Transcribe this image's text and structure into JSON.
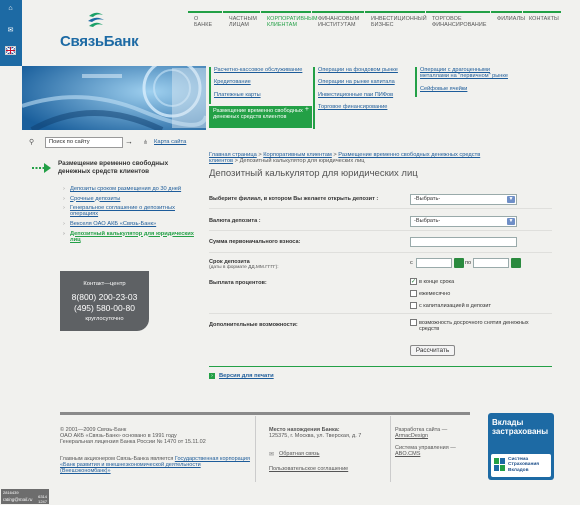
{
  "brand": {
    "name": "СвязьБанк"
  },
  "topnav": [
    {
      "label": "О БАНКЕ",
      "active": false
    },
    {
      "label": "ЧАСТНЫМ ЛИЦАМ",
      "active": false
    },
    {
      "label": "КОРПОРАТИВНЫМ КЛИЕНТАМ",
      "active": true
    },
    {
      "label": "ФИНАНСОВЫМ ИНСТИТУТАМ",
      "active": false
    },
    {
      "label": "ИНВЕСТИЦИОННЫЙ БИЗНЕС",
      "active": false
    },
    {
      "label": "ТОРГОВОЕ ФИНАНСИРОВАНИЕ",
      "active": false
    },
    {
      "label": "ФИЛИАЛЫ",
      "active": false
    },
    {
      "label": "КОНТАКТЫ",
      "active": false
    }
  ],
  "submenu": {
    "col1": [
      "Расчетно-кассовое обслуживание",
      "Кредитование",
      "Платежные карты"
    ],
    "col1_active": "Размещение временно свободных денежных средств клиентов",
    "col2": [
      "Операции на фондовом рынке",
      "Операции на рынке капитала",
      "Инвестиционные паи ПИФов",
      "Торговое финансирование"
    ],
    "col3": [
      "Операции с драгоценными металлами на \"первичном\" рынке",
      "Сейфовые ячейки"
    ]
  },
  "search": {
    "placeholder": "Поиск по сайту",
    "go": "→",
    "sitemap": "Карта сайта"
  },
  "left_menu": {
    "title": "Размещение временно свободных денежных средств клиентов",
    "items": [
      {
        "label": "Депозиты сроком размещения до 30 дней",
        "current": false
      },
      {
        "label": "Срочные депозиты",
        "current": false
      },
      {
        "label": "Генеральное соглашение о депозитных операциях",
        "current": false
      },
      {
        "label": "Векселя ОАО АКБ «Связь-Банк»",
        "current": false
      },
      {
        "label": "Депозитный калькулятор для юридических лиц",
        "current": true
      }
    ]
  },
  "contact": {
    "title": "Контакт—центр",
    "phone1": "8(800) 200-23-03",
    "phone2": "(495) 580-00-80",
    "hours": "круглосуточно"
  },
  "breadcrumb": {
    "items": [
      "Главная страница",
      "Корпоративным клиентам",
      "Размещение временно свободных денежных средств клиентов"
    ],
    "current": "Депозитный калькулятор для юридических лиц"
  },
  "page_title": "Депозитный калькулятор для юридических лиц",
  "form": {
    "branch_label": "Выберите филиал, в котором Вы желаете открыть депозит :",
    "branch_value": "-Выбрать-",
    "currency_label": "Валюта депозита :",
    "currency_value": "-Выбрать-",
    "amount_label": "Сумма первоначального взноса:",
    "term_label": "Срок депозита",
    "term_hint": "(даты в формате ДД.ММ.ГГГГ):",
    "term_from": "с",
    "term_to": "по",
    "payout_label": "Выплата процентов:",
    "payout_options": [
      {
        "label": "в конце срока",
        "checked": true
      },
      {
        "label": "ежемесячно",
        "checked": false
      },
      {
        "label": "с капитализацией в депозит",
        "checked": false
      }
    ],
    "extra_label": "Дополнительные возможности:",
    "extra_option": "возможность досрочного снятия денежных средств",
    "submit": "Рассчитать"
  },
  "print_link": "Версия для печати",
  "footer": {
    "copy1": "© 2001—2009 Связь-Банк",
    "copy2": "ОАО АКБ «Связь-Банк» основано в 1991 году",
    "copy3": "Генеральная лицензия Банка России № 1470 от 15.11.02",
    "shareholder_prefix": "Главным акционером Связь-Банка является ",
    "shareholder_link": "Государственная корпорация «Банк развития и внешнеэкономической деятельности (Внешэкономбанк)»",
    "location_label": "Место нахождения Банка:",
    "address": "125375, г. Москва, ул. Тверская, д. 7",
    "feedback": "Обратная связь",
    "agreement": "Пользовательское соглашение",
    "dev_label": "Разработка сайта —",
    "dev_name": "ArmacDesign",
    "cms_label": "Система управления —",
    "cms_name": "ABO.CMS",
    "deposit_badge": "Вклады застрахованы",
    "dia_text": "Система Страхования Вкладов"
  },
  "counter": {
    "label": "rating@mail.ru",
    "num1": "2816439",
    "num2": "6314",
    "num3": "1247"
  }
}
